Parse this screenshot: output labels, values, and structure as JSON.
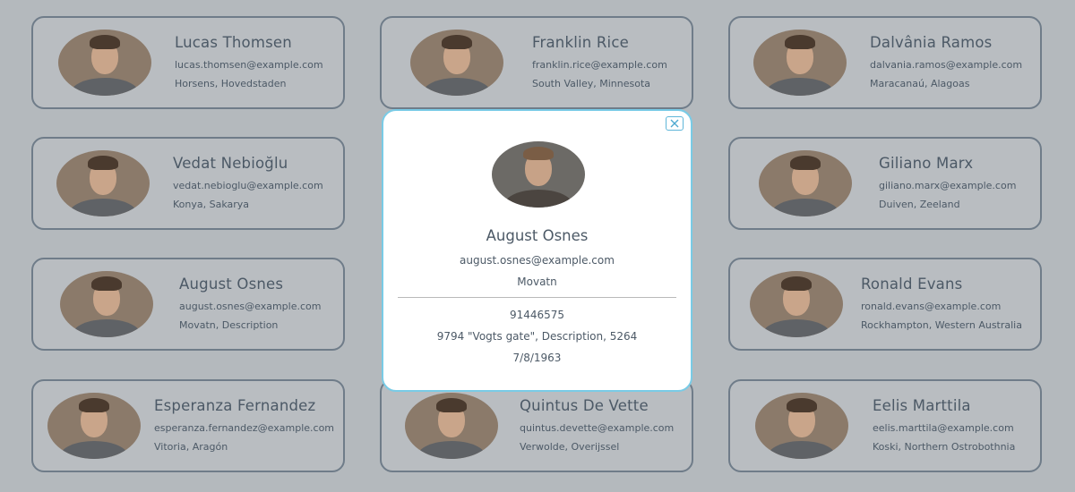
{
  "cards": [
    {
      "name": "Lucas Thomsen",
      "email": "lucas.thomsen@example.com",
      "location": "Horsens, Hovedstaden"
    },
    {
      "name": "Franklin Rice",
      "email": "franklin.rice@example.com",
      "location": "South Valley, Minnesota"
    },
    {
      "name": "Dalvânia Ramos",
      "email": "dalvania.ramos@example.com",
      "location": "Maracanaú, Alagoas"
    },
    {
      "name": "Vedat Nebioğlu",
      "email": "vedat.nebioglu@example.com",
      "location": "Konya, Sakarya"
    },
    {
      "name": "Giliano Marx",
      "email": "giliano.marx@example.com",
      "location": "Duiven, Zeeland"
    },
    {
      "name": "August Osnes",
      "email": "august.osnes@example.com",
      "location": "Movatn, Description"
    },
    {
      "name": "Ronald Evans",
      "email": "ronald.evans@example.com",
      "location": "Rockhampton, Western Australia"
    },
    {
      "name": "Esperanza Fernandez",
      "email": "esperanza.fernandez@example.com",
      "location": "Vitoria, Aragón"
    },
    {
      "name": "Quintus De Vette",
      "email": "quintus.devette@example.com",
      "location": "Verwolde, Overijssel"
    },
    {
      "name": "Eelis Marttila",
      "email": "eelis.marttila@example.com",
      "location": "Koski, Northern Ostrobothnia"
    }
  ],
  "modal": {
    "name": "August Osnes",
    "email": "august.osnes@example.com",
    "city": "Movatn",
    "phone": "91446575",
    "address": "9794 \"Vogts gate\", Description, 5264",
    "dob": "7/8/1963",
    "close_icon": "close-icon",
    "border_color": "#79cbe6"
  }
}
